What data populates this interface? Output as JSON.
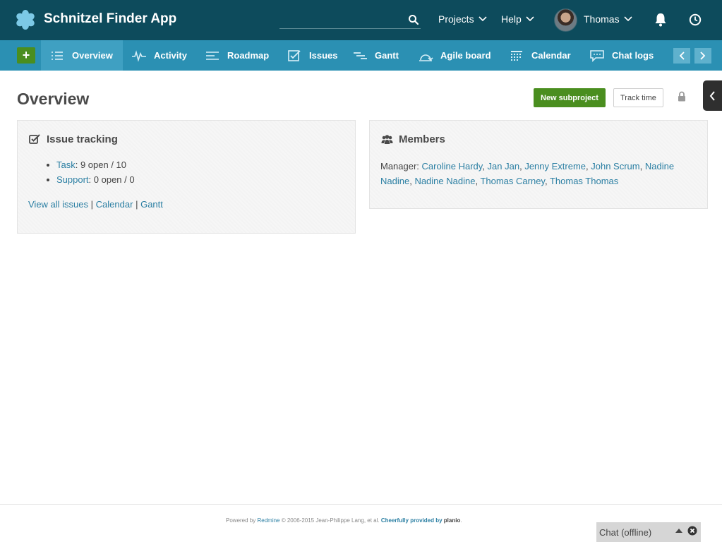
{
  "header": {
    "app_title": "Schnitzel Finder App",
    "search_placeholder": "",
    "nav": {
      "projects": "Projects",
      "help": "Help",
      "user": "Thomas"
    }
  },
  "project_nav": {
    "tabs": [
      {
        "label": "Overview",
        "icon": "list-icon",
        "active": true
      },
      {
        "label": "Activity",
        "icon": "pulse-icon"
      },
      {
        "label": "Roadmap",
        "icon": "roadmap-icon"
      },
      {
        "label": "Issues",
        "icon": "checkbox-icon"
      },
      {
        "label": "Gantt",
        "icon": "gantt-icon"
      },
      {
        "label": "Agile board",
        "icon": "agile-board-icon"
      },
      {
        "label": "Calendar",
        "icon": "calendar-icon"
      },
      {
        "label": "Chat logs",
        "icon": "chat-icon"
      }
    ]
  },
  "page": {
    "title": "Overview",
    "new_subproject": "New subproject",
    "track_time": "Track time"
  },
  "issue_tracking": {
    "title": "Issue tracking",
    "items": [
      {
        "tracker": "Task",
        "counts": ": 9 open / 10"
      },
      {
        "tracker": "Support",
        "counts": ": 0 open / 0"
      }
    ],
    "links": {
      "all": "View all issues",
      "calendar": "Calendar",
      "gantt": "Gantt",
      "sep": "|"
    }
  },
  "members": {
    "title": "Members",
    "role": "Manager:",
    "names": [
      "Caroline Hardy",
      "Jan Jan",
      "Jenny Extreme",
      "John Scrum",
      "Nadine Nadine",
      "Nadine Nadine",
      "Thomas Carney",
      "Thomas Thomas"
    ]
  },
  "footer": {
    "powered": "Powered by",
    "redmine": "Redmine",
    "copyright": "© 2006-2015 Jean-Philippe Lang, et al.",
    "provided": "Cheerfully provided by",
    "brand": "planio",
    "period": "."
  },
  "chat": {
    "label": "Chat (offline)"
  },
  "colors": {
    "header": "#0d4b5c",
    "project_nav": "#2b90b3",
    "accent_green": "#4a8e1f",
    "link": "#2b7fa3"
  }
}
